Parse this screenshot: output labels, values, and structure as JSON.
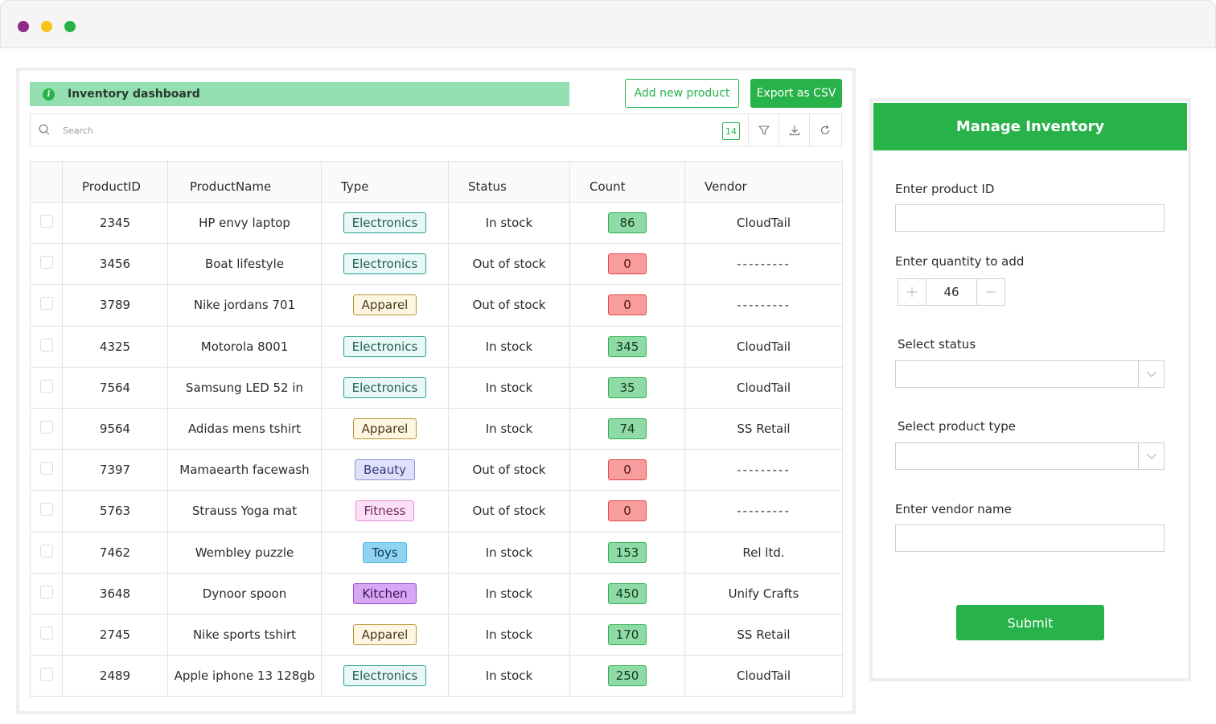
{
  "window": {
    "dots": [
      "#8e2a8c",
      "#f5c518",
      "#27b24a"
    ]
  },
  "banner": {
    "icon": "info-icon",
    "label": "Inventory dashboard"
  },
  "actions": {
    "add_label": "Add new product",
    "export_label": "Export as CSV"
  },
  "search": {
    "placeholder": "Search",
    "count": "14",
    "tools": [
      "filter-icon",
      "download-icon",
      "refresh-icon"
    ]
  },
  "table": {
    "headers": [
      "ProductID",
      "ProductName",
      "Type",
      "Status",
      "Count",
      "Vendor"
    ],
    "rows": [
      {
        "id": "2345",
        "name": "HP envy laptop",
        "type": "Electronics",
        "type_class": "electronics",
        "status": "In stock",
        "count": "86",
        "count_class": "green",
        "vendor": "CloudTail"
      },
      {
        "id": "3456",
        "name": "Boat lifestyle",
        "type": "Electronics",
        "type_class": "electronics",
        "status": "Out of stock",
        "count": "0",
        "count_class": "red",
        "vendor": "---------"
      },
      {
        "id": "3789",
        "name": "Nike jordans 701",
        "type": "Apparel",
        "type_class": "apparel",
        "status": "Out of stock",
        "count": "0",
        "count_class": "red",
        "vendor": "---------"
      },
      {
        "id": "4325",
        "name": "Motorola 8001",
        "type": "Electronics",
        "type_class": "electronics",
        "status": "In stock",
        "count": "345",
        "count_class": "green",
        "vendor": "CloudTail"
      },
      {
        "id": "7564",
        "name": "Samsung LED 52 in",
        "type": "Electronics",
        "type_class": "electronics",
        "status": "In stock",
        "count": "35",
        "count_class": "green",
        "vendor": "CloudTail"
      },
      {
        "id": "9564",
        "name": "Adidas mens tshirt",
        "type": "Apparel",
        "type_class": "apparel",
        "status": "In stock",
        "count": "74",
        "count_class": "green",
        "vendor": "SS Retail"
      },
      {
        "id": "7397",
        "name": "Mamaearth facewash",
        "type": "Beauty",
        "type_class": "beauty",
        "status": "Out of stock",
        "count": "0",
        "count_class": "red",
        "vendor": "---------"
      },
      {
        "id": "5763",
        "name": "Strauss Yoga mat",
        "type": "Fitness",
        "type_class": "fitness",
        "status": "Out of stock",
        "count": "0",
        "count_class": "red",
        "vendor": "---------"
      },
      {
        "id": "7462",
        "name": "Wembley puzzle",
        "type": "Toys",
        "type_class": "toys",
        "status": "In stock",
        "count": "153",
        "count_class": "green",
        "vendor": "Rel ltd."
      },
      {
        "id": "3648",
        "name": "Dynoor spoon",
        "type": "Kitchen",
        "type_class": "kitchen",
        "status": "In stock",
        "count": "450",
        "count_class": "green",
        "vendor": "Unify Crafts"
      },
      {
        "id": "2745",
        "name": "Nike sports tshirt",
        "type": "Apparel",
        "type_class": "apparel",
        "status": "In stock",
        "count": "170",
        "count_class": "green",
        "vendor": "SS Retail"
      },
      {
        "id": "2489",
        "name": "Apple iphone 13 128gb",
        "type": "Electronics",
        "type_class": "electronics",
        "status": "In stock",
        "count": "250",
        "count_class": "green",
        "vendor": "CloudTail"
      }
    ]
  },
  "form": {
    "title": "Manage Inventory",
    "product_id_label": "Enter product ID",
    "product_id_value": "",
    "quantity_label": "Enter quantity to add",
    "quantity_value": "46",
    "status_label": "Select status",
    "status_value": "",
    "type_label": "Select product type",
    "type_value": "",
    "vendor_label": "Enter vendor name",
    "vendor_value": "",
    "submit_label": "Submit"
  },
  "colors": {
    "accent": "#27b24a",
    "banner": "#94dfb0"
  }
}
